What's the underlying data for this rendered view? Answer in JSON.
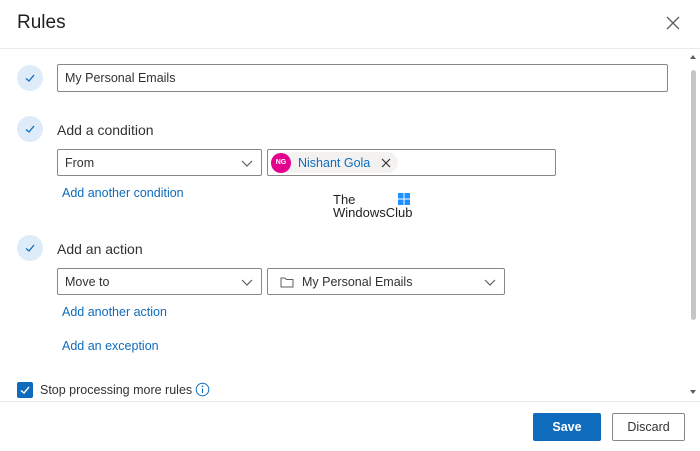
{
  "dialog": {
    "title": "Rules"
  },
  "rule_name": {
    "value": "My Personal Emails"
  },
  "condition": {
    "label": "Add a condition",
    "field_selected": "From",
    "person": {
      "initials": "NG",
      "name": "Nishant Gola"
    },
    "add_another_link": "Add another condition"
  },
  "watermark": {
    "line1": "The",
    "line2": "WindowsClub"
  },
  "action": {
    "label": "Add an action",
    "action_selected": "Move to",
    "folder_selected": "My Personal Emails",
    "add_another_link": "Add another action"
  },
  "exception": {
    "add_link": "Add an exception"
  },
  "stop_processing": {
    "label": "Stop processing more rules",
    "checked": true
  },
  "footer": {
    "save_label": "Save",
    "discard_label": "Discard"
  },
  "colors": {
    "accent": "#0f6cbd",
    "avatar": "#e3008c",
    "step_circle": "#deecf9"
  },
  "icons": {
    "close": "close-icon",
    "check": "checkmark-icon",
    "chevron": "chevron-down-icon",
    "folder": "folder-icon",
    "remove": "remove-icon",
    "info": "info-icon"
  }
}
